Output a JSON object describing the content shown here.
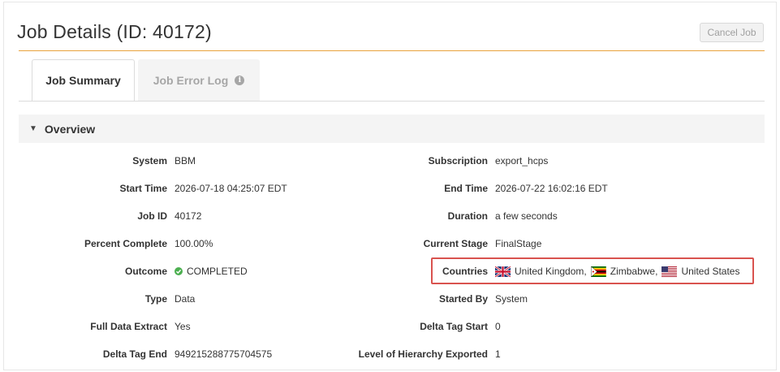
{
  "header": {
    "title": "Job Details (ID: 40172)",
    "cancel_label": "Cancel Job"
  },
  "tabs": [
    {
      "label": "Job Summary",
      "active": true
    },
    {
      "label": "Job Error Log",
      "active": false
    }
  ],
  "overview": {
    "heading": "Overview",
    "left": [
      {
        "label": "System",
        "value": "BBM"
      },
      {
        "label": "Start Time",
        "value": "2026-07-18 04:25:07 EDT"
      },
      {
        "label": "Job ID",
        "value": "40172"
      },
      {
        "label": "Percent Complete",
        "value": "100.00%"
      },
      {
        "label": "Outcome",
        "value": "COMPLETED"
      },
      {
        "label": "Type",
        "value": "Data"
      },
      {
        "label": "Full Data Extract",
        "value": "Yes"
      },
      {
        "label": "Delta Tag End",
        "value": "949215288775704575"
      }
    ],
    "right": [
      {
        "label": "Subscription",
        "value": "export_hcps"
      },
      {
        "label": "End Time",
        "value": "2026-07-22 16:02:16 EDT"
      },
      {
        "label": "Duration",
        "value": "a few seconds"
      },
      {
        "label": "Current Stage",
        "value": "FinalStage"
      },
      {
        "label": "Countries",
        "value": ""
      },
      {
        "label": "Started By",
        "value": "System"
      },
      {
        "label": "Delta Tag Start",
        "value": "0"
      },
      {
        "label": "Level of Hierarchy Exported",
        "value": "1"
      }
    ],
    "countries": [
      {
        "name": "United Kingdom",
        "sep": ",",
        "flag": "gb-flag-icon"
      },
      {
        "name": "Zimbabwe",
        "sep": ",",
        "flag": "zw-flag-icon"
      },
      {
        "name": "United States",
        "sep": "",
        "flag": "us-flag-icon"
      }
    ]
  },
  "colors": {
    "accent_rule": "#e8a33d",
    "highlight": "#d9534f",
    "success": "#4caf50"
  }
}
